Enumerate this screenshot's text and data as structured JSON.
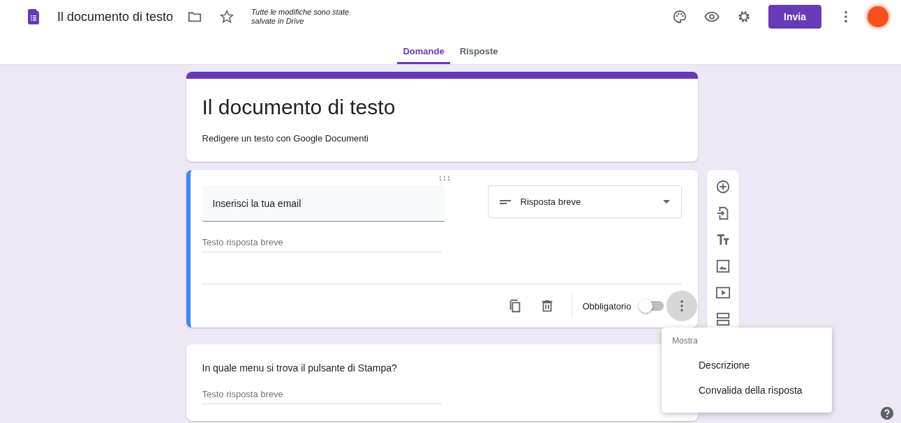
{
  "header": {
    "title": "Il documento di testo",
    "save_status": "Tutte le modifiche sono state salvate in Drive",
    "send_button": "Invia"
  },
  "tabs": [
    {
      "label": "Domande",
      "selected": true
    },
    {
      "label": "Risposte",
      "selected": false
    }
  ],
  "form_header": {
    "title": "Il documento di testo",
    "description": "Redigere un testo con Google Documenti"
  },
  "questions": [
    {
      "title": "Inserisci la tua email",
      "answer_placeholder": "Testo risposta breve",
      "active": true,
      "type": "Risposta breve",
      "required_label": "Obbligatorio",
      "required": false
    },
    {
      "title": "In quale menu si trova il pulsante di Stampa?",
      "answer_placeholder": "Testo risposta breve",
      "active": false
    }
  ],
  "menu": {
    "heading": "Mostra",
    "items": [
      "Descrizione",
      "Convalida della risposta"
    ]
  }
}
